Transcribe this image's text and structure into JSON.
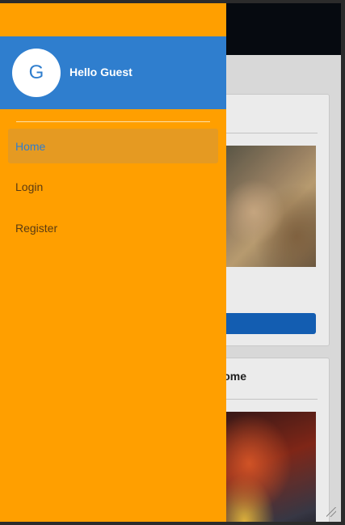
{
  "drawer": {
    "avatar_letter": "G",
    "greeting": "Hello Guest",
    "menu": [
      {
        "label": "Home",
        "active": true
      },
      {
        "label": "Login",
        "active": false
      },
      {
        "label": "Register",
        "active": false
      }
    ]
  },
  "background": {
    "subtitle_fragment": "i",
    "card2_title_fragment": "ome"
  },
  "colors": {
    "drawer_bg": "#ff9f00",
    "header_bg": "#2f7ece",
    "active_item_bg": "#e59a22",
    "topbar_bg": "#070b12",
    "button_blue": "#1565c0"
  }
}
